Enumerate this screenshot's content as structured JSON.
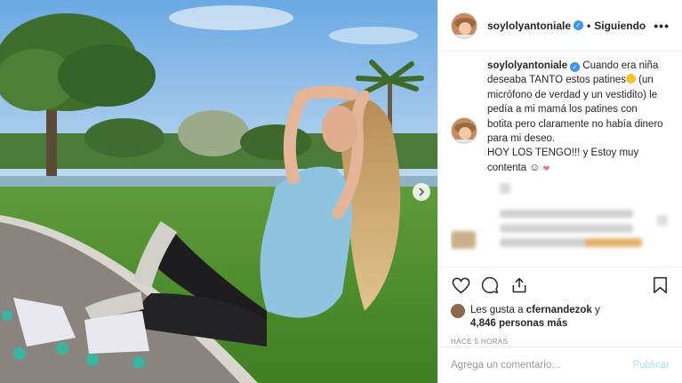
{
  "post": {
    "username": "soylolyantoniale",
    "verified_mark": "✓",
    "separator": "•",
    "follow_status": "Siguiendo",
    "more_label": "•••"
  },
  "caption": {
    "username": "soylolyantoniale",
    "text_part1": " Cuando era niña deseaba TANTO estos patines",
    "text_part2": " (un micrófono de verdad y un vestidito) le pedía a mi mamá los patines con botita pero claramente no había dinero para mi deseo.",
    "line2": "HOY LOS TENGO!!! y Estoy muy contenta",
    "line2_emoji": "☺"
  },
  "likes": {
    "prefix": "Les gusta a",
    "first_user": "cfernandezok",
    "conj": "y",
    "count": "4,846 personas más"
  },
  "timestamp": "HACE 5 HORAS",
  "comment_input": {
    "placeholder": "Agrega un comentario..."
  },
  "publish_label": "Publicar",
  "icons": {
    "like": "heart-icon",
    "comment": "comment-icon",
    "share": "share-icon",
    "save": "bookmark-icon",
    "next": "chevron-right-icon"
  },
  "colors": {
    "accent": "#3897f0",
    "publish_disabled": "#b2dffc",
    "muted": "#8e8e8e"
  }
}
